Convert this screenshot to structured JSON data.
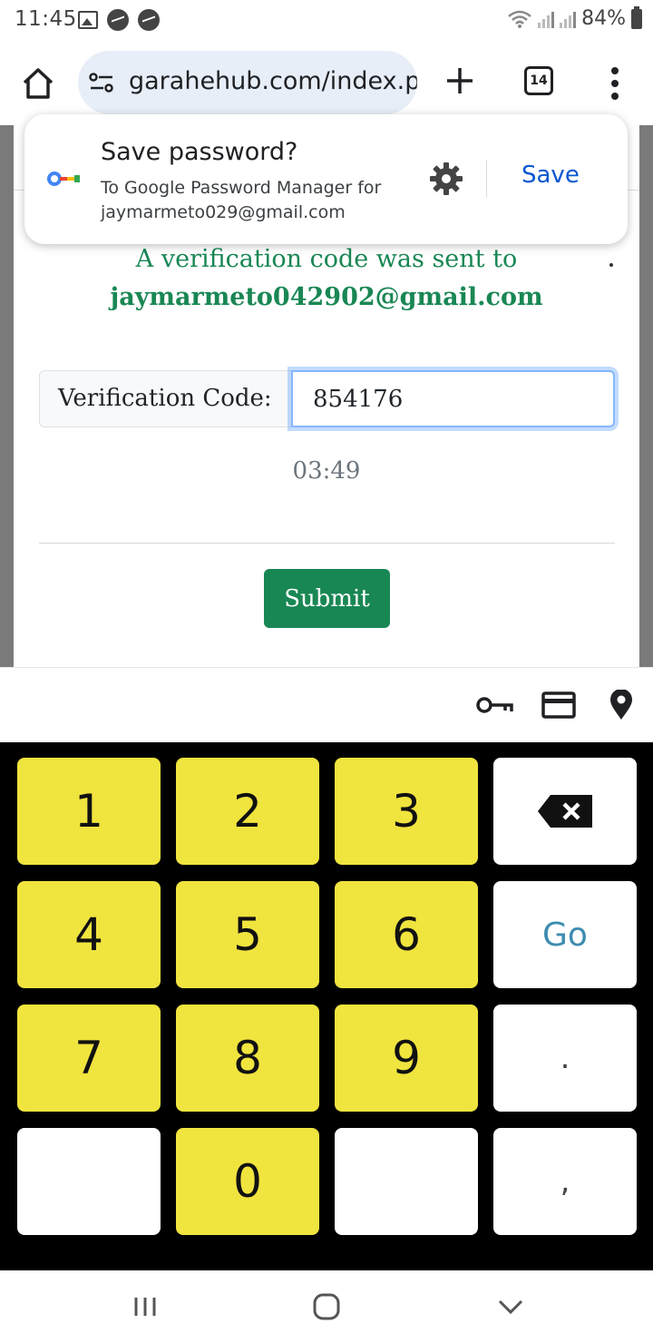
{
  "status_bar": {
    "time": "11:45",
    "battery": "84%"
  },
  "browser": {
    "url": "garahehub.com/index.php",
    "tab_count": "14"
  },
  "save_password_popup": {
    "title": "Save password?",
    "subtitle_line1": "To Google Password Manager for",
    "subtitle_line2": "jaymarmeto029@gmail.com",
    "save_label": "Save"
  },
  "verification": {
    "message": "A verification code was sent to",
    "email": "jaymarmeto042902@gmail.com",
    "field_label": "Verification Code:",
    "field_value": "854176",
    "timer": "03:49",
    "submit_label": "Submit"
  },
  "keyboard": {
    "keys": {
      "k1": "1",
      "k2": "2",
      "k3": "3",
      "k4": "4",
      "k5": "5",
      "k6": "6",
      "k7": "7",
      "k8": "8",
      "k9": "9",
      "k0": "0",
      "go": "Go",
      "period": ".",
      "comma": ","
    }
  },
  "icons": {
    "autofill": [
      "key-icon",
      "card-icon",
      "location-icon"
    ],
    "nav": [
      "recents-icon",
      "home-icon",
      "back-icon"
    ]
  },
  "colors": {
    "accent_green": "#198754",
    "link_blue": "#0b57d0",
    "key_yellow": "#f0e43e",
    "go_blue": "#3e8cb0"
  }
}
